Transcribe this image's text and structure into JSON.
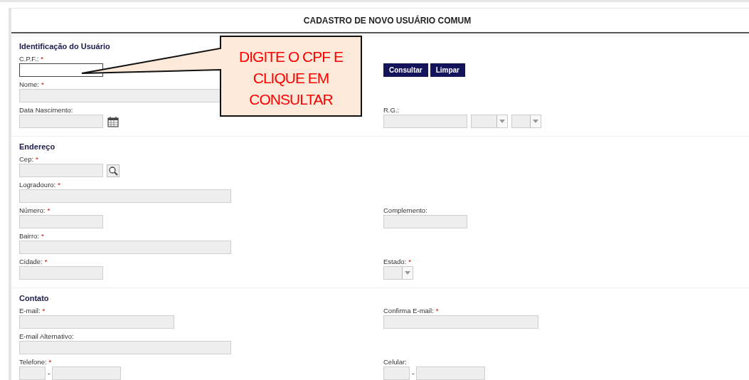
{
  "form": {
    "title": "CADASTRO DE NOVO USUÁRIO COMUM"
  },
  "sections": [
    {
      "title": "Identificação do Usuário",
      "rows": [
        {
          "left": {
            "label": "C.P.F.:",
            "mark": "*",
            "kind": "short",
            "disabled": false
          },
          "right": {
            "kind": "buttons",
            "buttons": [
              "Consultar",
              "Limpar"
            ]
          }
        },
        {
          "left": {
            "label": "Nome:",
            "mark": "*",
            "kind": "long",
            "disabled": true
          }
        },
        {
          "left": {
            "label": "Data Nascimento:",
            "kind": "date",
            "disabled": true
          },
          "right": {
            "label": "R.G.:",
            "kind": "rg",
            "disabled": true
          }
        }
      ]
    },
    {
      "title": "Endereço",
      "rows": [
        {
          "left": {
            "label": "Cep:",
            "mark": "*",
            "kind": "cep",
            "disabled": true
          }
        },
        {
          "left": {
            "label": "Logradouro:",
            "mark": "*",
            "kind": "long",
            "disabled": true
          }
        },
        {
          "left": {
            "label": "Número:",
            "mark": "*",
            "kind": "short",
            "disabled": true
          },
          "right": {
            "label": "Complemento:",
            "kind": "short",
            "disabled": true
          }
        },
        {
          "left": {
            "label": "Bairro:",
            "mark": "*",
            "kind": "long",
            "disabled": true
          }
        },
        {
          "left": {
            "label": "Cidade:",
            "mark": "*",
            "kind": "short",
            "disabled": true
          },
          "right": {
            "label": "Estado:",
            "mark": "*",
            "kind": "select",
            "disabled": true
          }
        }
      ]
    },
    {
      "title": "Contato",
      "rows": [
        {
          "left": {
            "label": "E-mail:",
            "mark": "*",
            "kind": "medium",
            "disabled": true
          },
          "right": {
            "label": "Confirma E-mail:",
            "mark": "*",
            "kind": "medium",
            "disabled": true
          }
        },
        {
          "left": {
            "label": "E-mail Alternativo:",
            "kind": "long",
            "disabled": true
          }
        },
        {
          "left": {
            "label": "Telefone:",
            "mark": "*",
            "kind": "phone",
            "separator": "-",
            "disabled": true
          },
          "right": {
            "label": "Celular:",
            "kind": "phone",
            "separator": "-",
            "disabled": true
          }
        }
      ]
    }
  ],
  "callout": {
    "lines": [
      "DIGITE O CPF E",
      "CLIQUE EM",
      "CONSULTAR"
    ]
  }
}
